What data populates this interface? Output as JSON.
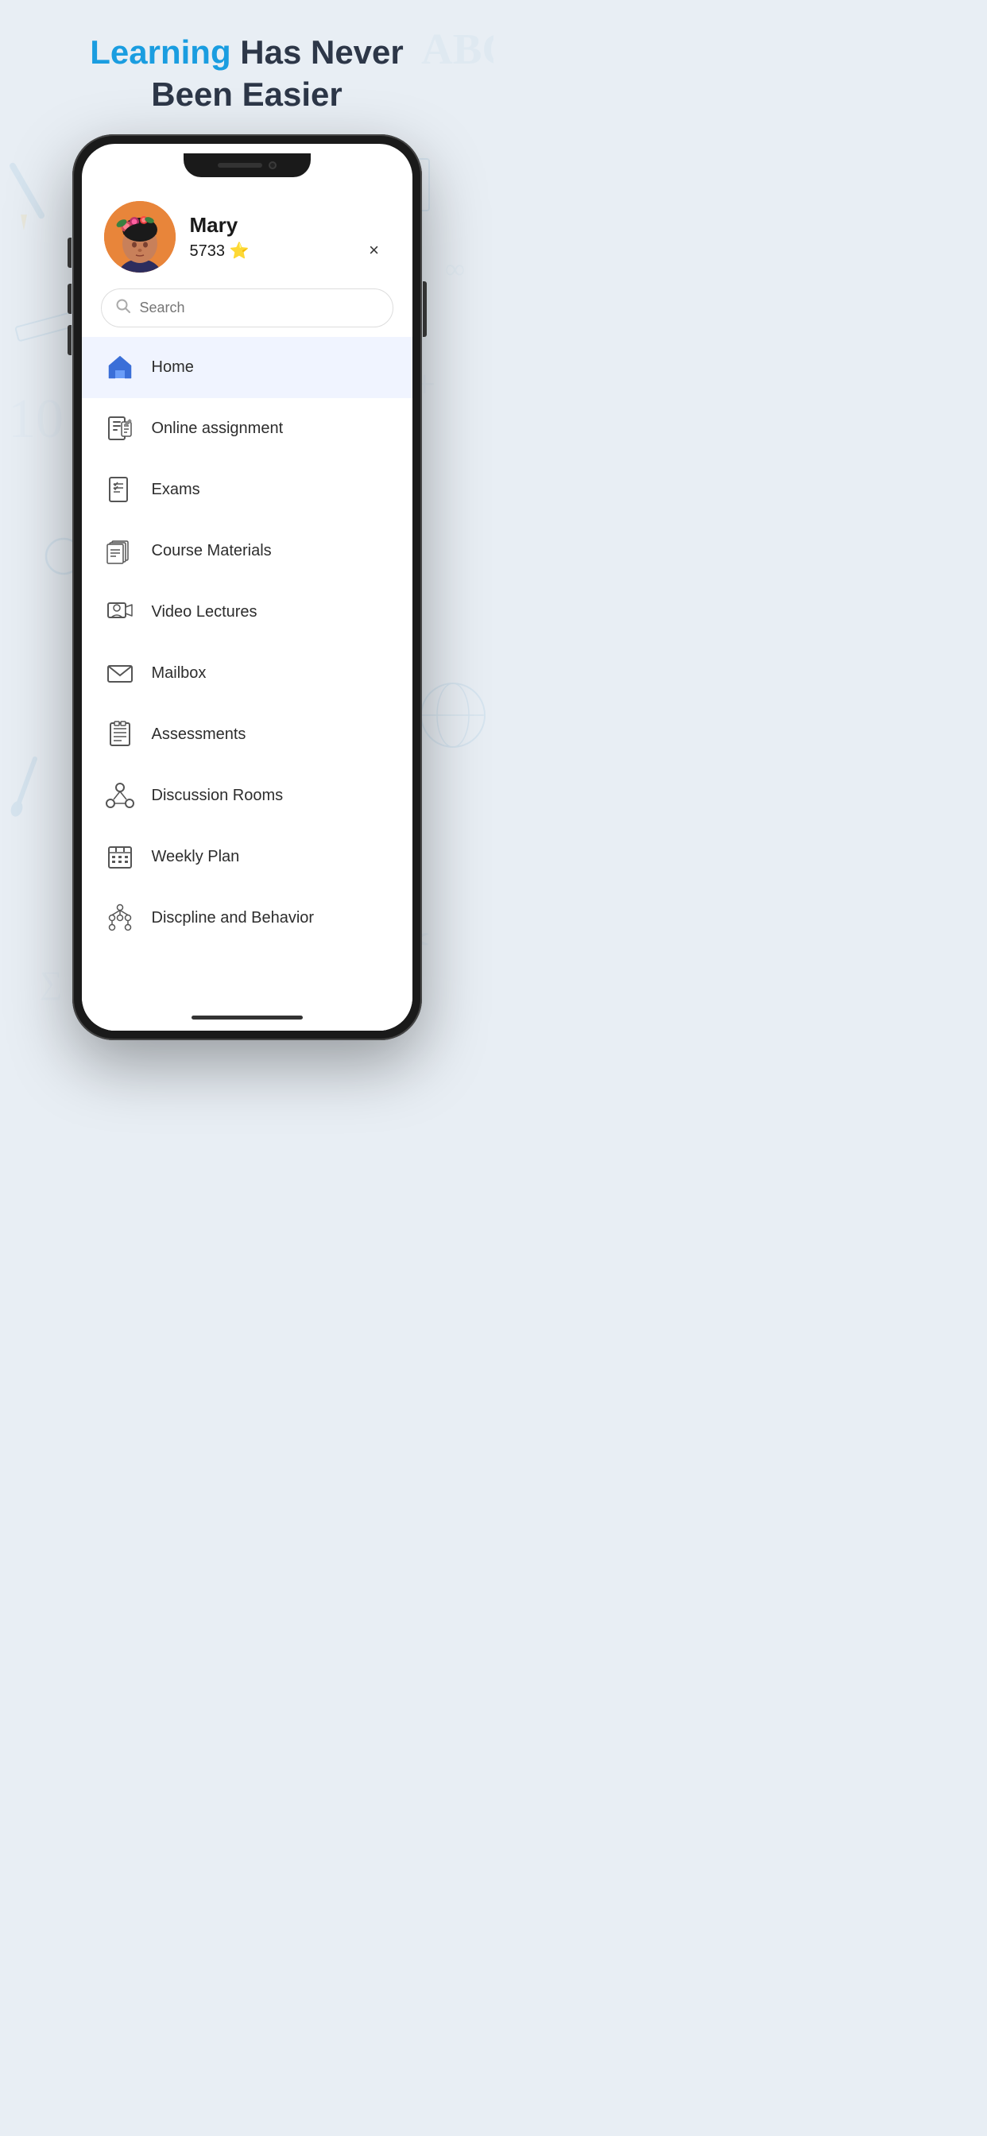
{
  "header": {
    "line1_blue": "Learning",
    "line1_rest": " Has Never",
    "line2": "Been Easier"
  },
  "user": {
    "name": "Mary",
    "score": "5733",
    "score_icon": "⭐"
  },
  "search": {
    "placeholder": "Search"
  },
  "close_button": "×",
  "menu": {
    "items": [
      {
        "id": "home",
        "label": "Home",
        "active": true
      },
      {
        "id": "online-assignment",
        "label": "Online assignment",
        "active": false
      },
      {
        "id": "exams",
        "label": "Exams",
        "active": false
      },
      {
        "id": "course-materials",
        "label": "Course Materials",
        "active": false
      },
      {
        "id": "video-lectures",
        "label": "Video Lectures",
        "active": false
      },
      {
        "id": "mailbox",
        "label": "Mailbox",
        "active": false
      },
      {
        "id": "assessments",
        "label": "Assessments",
        "active": false
      },
      {
        "id": "discussion-rooms",
        "label": "Discussion Rooms",
        "active": false
      },
      {
        "id": "weekly-plan",
        "label": "Weekly Plan",
        "active": false
      },
      {
        "id": "discipline-behavior",
        "label": "Discpline and Behavior",
        "active": false
      }
    ]
  }
}
